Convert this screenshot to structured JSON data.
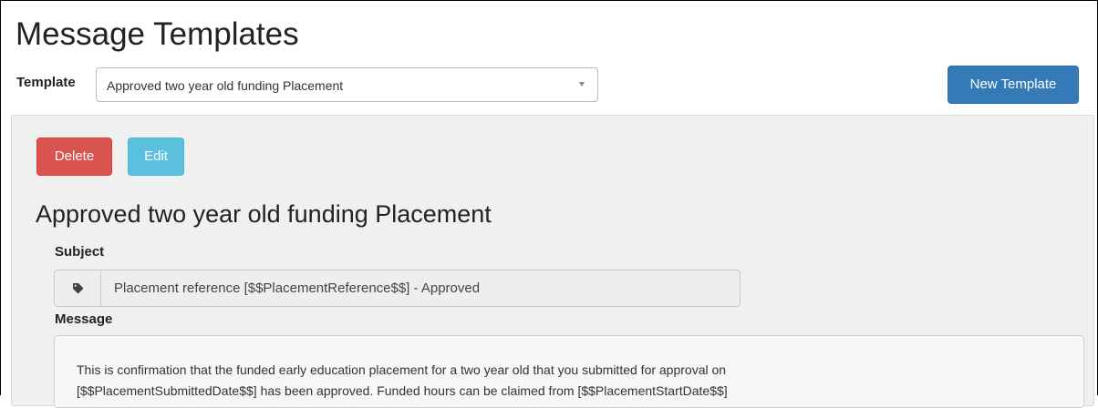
{
  "page": {
    "title": "Message Templates"
  },
  "template_picker": {
    "label": "Template",
    "selected": "Approved two year old funding Placement"
  },
  "toolbar": {
    "new_template_label": "New Template"
  },
  "detail": {
    "delete_label": "Delete",
    "edit_label": "Edit",
    "title": "Approved two year old funding Placement",
    "subject_label": "Subject",
    "subject_icon": "tag-icon",
    "subject_value": "Placement reference [$$PlacementReference$$] - Approved",
    "message_label": "Message",
    "message_lines": [
      "This is confirmation that the funded early education placement for a two year old that you submitted for approval on",
      "[$$PlacementSubmittedDate$$] has been approved. Funded hours can be claimed from [$$PlacementStartDate$$]"
    ]
  },
  "colors": {
    "primary": "#337ab7",
    "danger": "#d9534f",
    "info": "#5bc0de",
    "panel_bg": "#f0f0f0"
  }
}
